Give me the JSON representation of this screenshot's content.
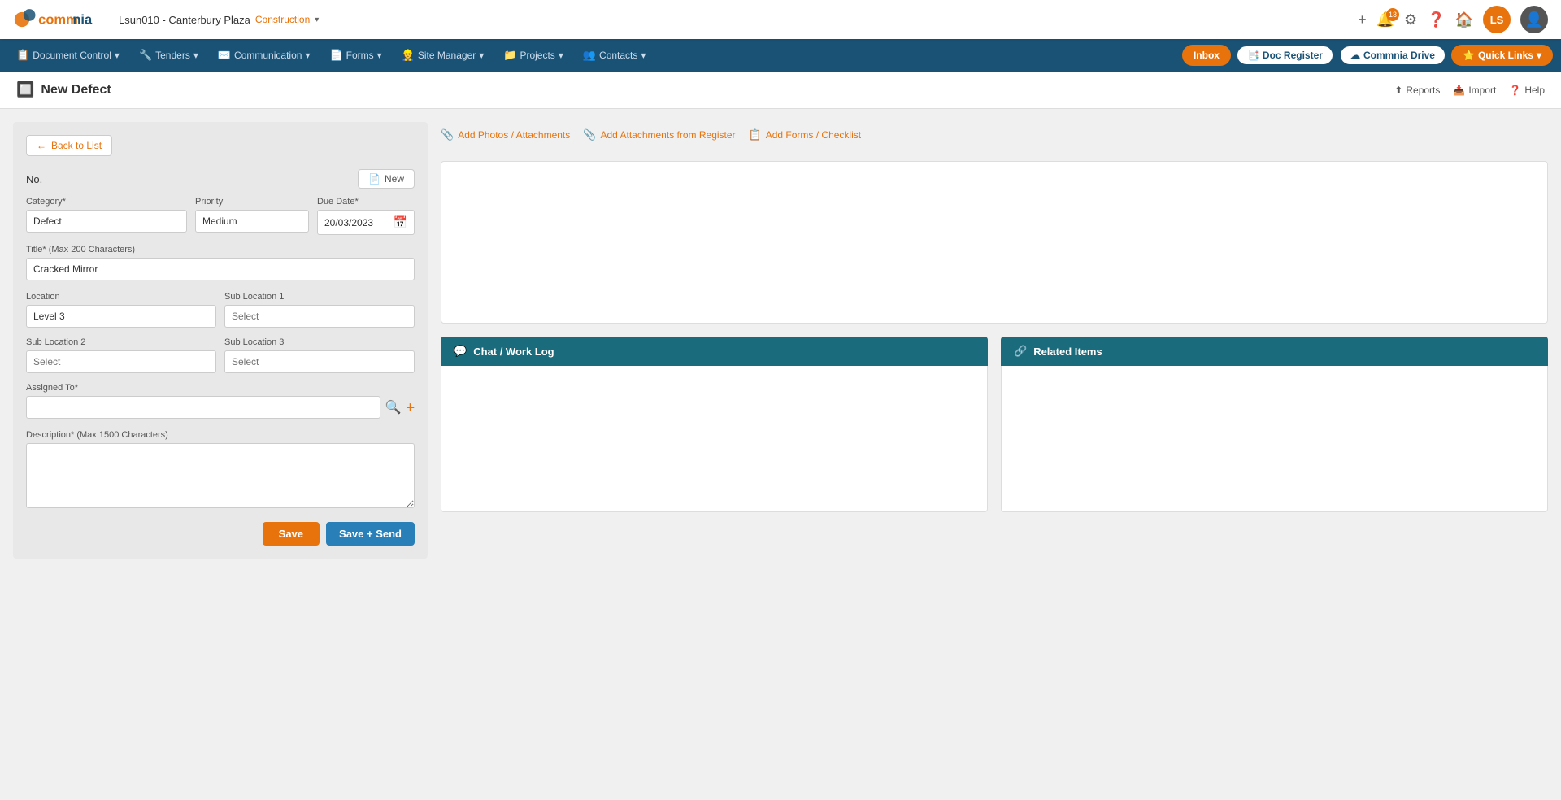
{
  "app": {
    "logo_text": "commnia"
  },
  "topbar": {
    "project": "Lsun010 - Canterbury Plaza",
    "project_tag": "Construction",
    "add_icon": "+",
    "notification_count": "13",
    "user_initials": "LS"
  },
  "secnav": {
    "items": [
      {
        "id": "doc-control",
        "label": "Document Control",
        "icon": "📋"
      },
      {
        "id": "tenders",
        "label": "Tenders",
        "icon": "🔧"
      },
      {
        "id": "communication",
        "label": "Communication",
        "icon": "✉️"
      },
      {
        "id": "forms",
        "label": "Forms",
        "icon": "📄"
      },
      {
        "id": "site-manager",
        "label": "Site Manager",
        "icon": "👷"
      },
      {
        "id": "projects",
        "label": "Projects",
        "icon": "📁"
      },
      {
        "id": "contacts",
        "label": "Contacts",
        "icon": "👥"
      }
    ],
    "inbox_label": "Inbox",
    "doc_register_label": "Doc Register",
    "commnia_drive_label": "Commnia Drive",
    "quick_links_label": "Quick Links"
  },
  "page": {
    "title": "New Defect",
    "reports_label": "Reports",
    "import_label": "Import",
    "help_label": "Help"
  },
  "form": {
    "back_label": "Back to List",
    "no_label": "No.",
    "new_label": "New",
    "category_label": "Category*",
    "category_value": "Defect",
    "priority_label": "Priority",
    "priority_value": "Medium",
    "due_date_label": "Due Date*",
    "due_date_value": "20/03/2023",
    "title_label": "Title* (Max 200 Characters)",
    "title_value": "Cracked Mirror",
    "location_label": "Location",
    "location_value": "Level 3",
    "sub_location1_label": "Sub Location 1",
    "sub_location1_placeholder": "Select",
    "sub_location2_label": "Sub Location 2",
    "sub_location2_placeholder": "Select",
    "sub_location3_label": "Sub Location 3",
    "sub_location3_placeholder": "Select",
    "assigned_to_label": "Assigned To*",
    "assigned_to_placeholder": "",
    "description_label": "Description* (Max 1500 Characters)",
    "save_label": "Save",
    "save_send_label": "Save + Send"
  },
  "attachments": {
    "add_photos_label": "Add Photos / Attachments",
    "add_from_register_label": "Add Attachments from Register",
    "add_forms_label": "Add Forms / Checklist"
  },
  "chat_panel": {
    "title": "Chat / Work Log",
    "icon": "💬"
  },
  "related_panel": {
    "title": "Related Items",
    "icon": "🔗"
  }
}
